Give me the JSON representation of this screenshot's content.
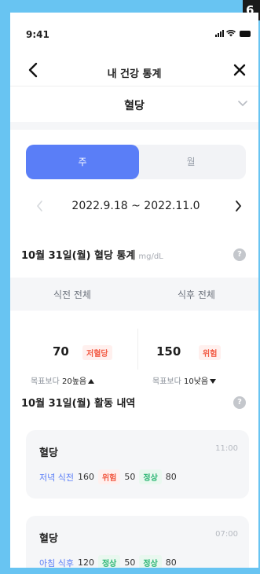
{
  "corner_badge": "6",
  "status_bar": {
    "time": "9:41"
  },
  "header": {
    "title": "내 건강 통계"
  },
  "selector": {
    "label": "혈당"
  },
  "segment": {
    "week": "주",
    "month": "월"
  },
  "date_range": {
    "text": "2022.9.18 ~ 2022.11.0"
  },
  "stats": {
    "title": "10월 31일(월) 혈당 통계",
    "unit": "mg/dL",
    "help": "?",
    "columns": [
      "식전 전체",
      "식후 전체"
    ],
    "before": {
      "value": "70",
      "badge": "저혈당",
      "goal_prefix": "목표보다",
      "goal_value": "20높음"
    },
    "after": {
      "value": "150",
      "badge": "위험",
      "goal_prefix": "목표보다",
      "goal_value": "10낮음"
    }
  },
  "activity": {
    "title": "10월 31일(월) 활동 내역",
    "help": "?",
    "cards": [
      {
        "title": "혈당",
        "time": "11:00",
        "meal": "저녁 식전",
        "v1": "160",
        "b1": "위험",
        "v2": "50",
        "b2": "정상",
        "v3": "80"
      },
      {
        "title": "혈당",
        "time": "07:00",
        "meal": "아침 식후",
        "v1": "120",
        "b1": "정상",
        "v2": "50",
        "b2": "정상",
        "v3": "80"
      }
    ]
  },
  "colors": {
    "accent": "#5a7ef7",
    "frame": "#68c4f2",
    "danger": "#f25b44",
    "normal": "#2bb673"
  }
}
